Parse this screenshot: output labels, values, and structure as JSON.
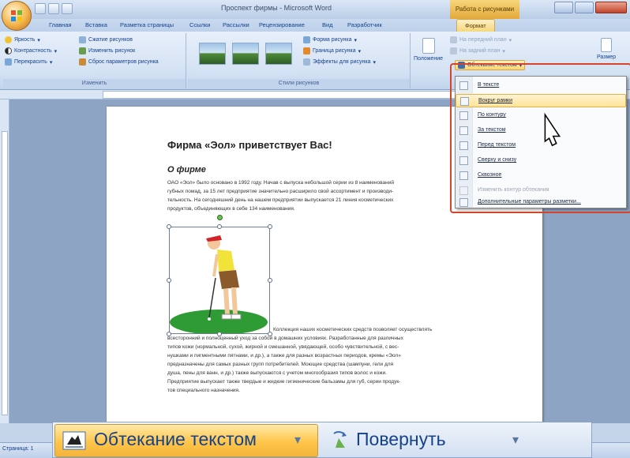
{
  "window": {
    "title": "Проспект фирмы - Microsoft Word",
    "context_title": "Работа с рисунками"
  },
  "tabs": [
    "Главная",
    "Вставка",
    "Разметка страницы",
    "Ссылки",
    "Рассылки",
    "Рецензирование",
    "Вид",
    "Разработчик",
    "Формат"
  ],
  "ribbon": {
    "group_adjust": {
      "label": "Изменить",
      "brightness": "Яркость",
      "contrast": "Контрастность",
      "recolor": "Перекрасить",
      "compress": "Сжатие рисунков",
      "change_picture": "Изменить рисунок",
      "reset_picture": "Сброс параметров рисунка"
    },
    "group_styles": {
      "label": "Стили рисунков",
      "shape": "Форма рисунка",
      "border": "Граница рисунка",
      "effects": "Эффекты для рисунка"
    },
    "group_arrange": {
      "position": "Положение",
      "bring_front": "На передний план",
      "send_back": "На задний план",
      "wrap_text": "Обтекание текстом",
      "size": "Размер"
    }
  },
  "document": {
    "heading": "Фирма «Эол» приветствует Вас!",
    "subheading": "О фирме",
    "para1": [
      "ОАО «Эол» было основано в 1992 году. Начав с выпуска небольшой серии из 8 наименований",
      "губных помад, за 15 лет предприятие значительно расширило свой ассортимент и производи-",
      "тельность. На сегодняшний день на нашем предприятии выпускается 21 линия косметических",
      "продуктов, объединяющих в себе 134 наименования."
    ],
    "para2_first": "Коллекция наших косметических средств позволяет осуществлять",
    "para2": [
      "всесторонний и полноценный уход за собой в домашних условиях. Разработанные для различных",
      "типов кожи (нормальной, сухой, жирной и смешанной, увядающей, особо чувствительной, с вес-",
      "нушками и пигментными пятнами, и др.), а также для разных возрастных периодов, кремы «Эол»",
      "предназначены для самых разных групп потребителей. Моющие средства (шампуни, гели для",
      "душа, пены для ванн, и др.) также выпускаются с учетом многообразия типов волос и кожи.",
      "Предприятие выпускает также твердые и жидкие гигиенические бальзамы для губ, серии продук-",
      "тов специального назначения."
    ]
  },
  "wrap_menu": {
    "items": [
      {
        "label": "В тексте",
        "state": "normal"
      },
      {
        "label": "Вокруг рамки",
        "state": "highlighted"
      },
      {
        "label": "По контуру",
        "state": "normal"
      },
      {
        "label": "За текстом",
        "state": "normal"
      },
      {
        "label": "Перед текстом",
        "state": "normal"
      },
      {
        "label": "Сверху и снизу",
        "state": "normal"
      },
      {
        "label": "Сквозное",
        "state": "normal"
      },
      {
        "label": "Изменить контур обтекания",
        "state": "disabled"
      },
      {
        "label": "Дополнительные параметры разметки...",
        "state": "normal"
      }
    ]
  },
  "status": {
    "page": "Страница: 1"
  },
  "zoom_callout": {
    "wrap_text": "Обтекание текстом",
    "rotate": "Повернуть"
  },
  "colors": {
    "accent": "#15428b",
    "highlight": "#ffe39a",
    "callout_border": "#d6452b"
  }
}
